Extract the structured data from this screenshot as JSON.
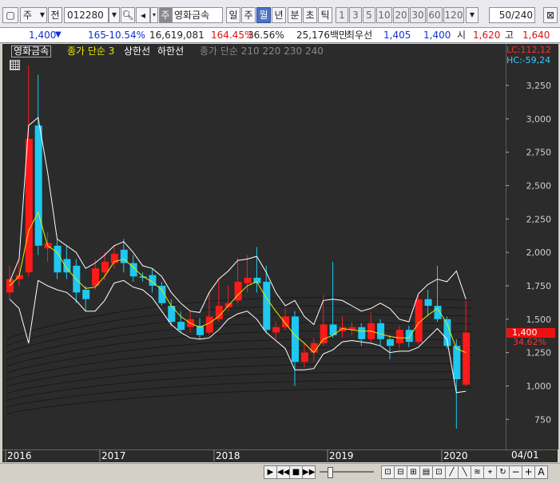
{
  "toolbar": {
    "market_type": "주",
    "prev_label": "전",
    "stock_code": "012280",
    "stock_name": "영화금속",
    "period_tabs": [
      "일",
      "주",
      "월",
      "년"
    ],
    "interval_tabs": [
      "분",
      "초",
      "틱"
    ],
    "number_tabs": [
      "1",
      "3",
      "5",
      "10",
      "20",
      "30",
      "60",
      "120"
    ],
    "count_value": "50",
    "count_total": "/240"
  },
  "info": {
    "price": "1,400",
    "change": "165",
    "change_pct": "-10.54%",
    "volume": "16,619,081",
    "vol_ratio": "164.45%",
    "turnover": "36.56%",
    "amount": "25,176백만",
    "best_ask_label": "최우선",
    "best_ask": "1,405",
    "best_bid": "1,400",
    "open_label": "시",
    "open": "1,620",
    "high_label": "고",
    "high": "1,640"
  },
  "legend": {
    "name": "영화금속",
    "close_ma": "종가 단순 3",
    "upper": "상한선",
    "lower": "하한선",
    "ribbon": "종가 단순 210 220 230 240"
  },
  "axis": {
    "lc_label": "LC:112,12",
    "hc_label": "HC:-59,24",
    "price_ticks": [
      "3,250",
      "3,000",
      "2,750",
      "2,500",
      "2,250",
      "2,000",
      "1,750",
      "1,500",
      "1,250",
      "1,000",
      "750"
    ],
    "current_price_label": "1,400",
    "current_pct_label": "34.62%",
    "year_labels": [
      "2016",
      "2017",
      "2018",
      "2019",
      "2020"
    ],
    "right_date": "04/01"
  },
  "colors": {
    "up": "#ff1a1a",
    "down": "#1ec8f0",
    "ma": "#e8e800",
    "band": "#ffffff",
    "background": "#2b2b2b"
  },
  "chart_data": {
    "type": "candlestick",
    "period": "monthly",
    "ylim": [
      650,
      3400
    ],
    "candles": [
      {
        "o": 1700,
        "c": 1800,
        "h": 1900,
        "l": 1650,
        "up": true
      },
      {
        "o": 1800,
        "c": 1830,
        "h": 1950,
        "l": 1750,
        "up": true
      },
      {
        "o": 1850,
        "c": 2850,
        "h": 3400,
        "l": 1820,
        "up": true
      },
      {
        "o": 2950,
        "c": 2050,
        "h": 3330,
        "l": 1980,
        "up": false
      },
      {
        "o": 2030,
        "c": 2070,
        "h": 2150,
        "l": 1930,
        "up": true
      },
      {
        "o": 2050,
        "c": 1850,
        "h": 2100,
        "l": 1800,
        "up": false
      },
      {
        "o": 1950,
        "c": 1850,
        "h": 2050,
        "l": 1800,
        "up": false
      },
      {
        "o": 1900,
        "c": 1700,
        "h": 1950,
        "l": 1620,
        "up": false
      },
      {
        "o": 1720,
        "c": 1650,
        "h": 1750,
        "l": 1560,
        "up": false
      },
      {
        "o": 1750,
        "c": 1880,
        "h": 1950,
        "l": 1720,
        "up": true
      },
      {
        "o": 1850,
        "c": 1930,
        "h": 2000,
        "l": 1790,
        "up": true
      },
      {
        "o": 1920,
        "c": 1990,
        "h": 2050,
        "l": 1880,
        "up": true
      },
      {
        "o": 2020,
        "c": 1920,
        "h": 2100,
        "l": 1850,
        "up": false
      },
      {
        "o": 1920,
        "c": 1820,
        "h": 1980,
        "l": 1780,
        "up": false
      },
      {
        "o": 1820,
        "c": 1810,
        "h": 1850,
        "l": 1780,
        "up": false
      },
      {
        "o": 1830,
        "c": 1750,
        "h": 1880,
        "l": 1700,
        "up": false
      },
      {
        "o": 1750,
        "c": 1620,
        "h": 1780,
        "l": 1600,
        "up": false
      },
      {
        "o": 1600,
        "c": 1480,
        "h": 1650,
        "l": 1450,
        "up": false
      },
      {
        "o": 1480,
        "c": 1420,
        "h": 1560,
        "l": 1400,
        "up": false
      },
      {
        "o": 1440,
        "c": 1500,
        "h": 1560,
        "l": 1400,
        "up": true
      },
      {
        "o": 1450,
        "c": 1380,
        "h": 1510,
        "l": 1350,
        "up": false
      },
      {
        "o": 1400,
        "c": 1520,
        "h": 1700,
        "l": 1380,
        "up": true
      },
      {
        "o": 1500,
        "c": 1600,
        "h": 1800,
        "l": 1480,
        "up": true
      },
      {
        "o": 1590,
        "c": 1620,
        "h": 1750,
        "l": 1560,
        "up": true
      },
      {
        "o": 1640,
        "c": 1780,
        "h": 1960,
        "l": 1620,
        "up": true
      },
      {
        "o": 1770,
        "c": 1810,
        "h": 1980,
        "l": 1700,
        "up": true
      },
      {
        "o": 1810,
        "c": 1770,
        "h": 2040,
        "l": 1700,
        "up": false
      },
      {
        "o": 1780,
        "c": 1420,
        "h": 1900,
        "l": 1400,
        "up": false
      },
      {
        "o": 1400,
        "c": 1440,
        "h": 1480,
        "l": 1350,
        "up": true
      },
      {
        "o": 1440,
        "c": 1520,
        "h": 1580,
        "l": 1420,
        "up": true
      },
      {
        "o": 1520,
        "c": 1180,
        "h": 1560,
        "l": 1000,
        "up": false
      },
      {
        "o": 1180,
        "c": 1250,
        "h": 1320,
        "l": 1140,
        "up": true
      },
      {
        "o": 1250,
        "c": 1320,
        "h": 1360,
        "l": 1180,
        "up": true
      },
      {
        "o": 1320,
        "c": 1460,
        "h": 1680,
        "l": 1300,
        "up": true
      },
      {
        "o": 1460,
        "c": 1380,
        "h": 1930,
        "l": 1360,
        "up": false
      },
      {
        "o": 1410,
        "c": 1440,
        "h": 1520,
        "l": 1360,
        "up": true
      },
      {
        "o": 1420,
        "c": 1440,
        "h": 1480,
        "l": 1380,
        "up": true
      },
      {
        "o": 1440,
        "c": 1350,
        "h": 1470,
        "l": 1300,
        "up": false
      },
      {
        "o": 1350,
        "c": 1470,
        "h": 1550,
        "l": 1320,
        "up": true
      },
      {
        "o": 1470,
        "c": 1350,
        "h": 1500,
        "l": 1300,
        "up": false
      },
      {
        "o": 1350,
        "c": 1300,
        "h": 1380,
        "l": 1200,
        "up": false
      },
      {
        "o": 1320,
        "c": 1420,
        "h": 1450,
        "l": 1280,
        "up": true
      },
      {
        "o": 1420,
        "c": 1330,
        "h": 1450,
        "l": 1290,
        "up": false
      },
      {
        "o": 1330,
        "c": 1650,
        "h": 1680,
        "l": 1310,
        "up": true
      },
      {
        "o": 1650,
        "c": 1600,
        "h": 1720,
        "l": 1520,
        "up": false
      },
      {
        "o": 1600,
        "c": 1500,
        "h": 1900,
        "l": 1480,
        "up": false
      },
      {
        "o": 1500,
        "c": 1300,
        "h": 1520,
        "l": 1280,
        "up": false
      },
      {
        "o": 1300,
        "c": 1050,
        "h": 1350,
        "l": 680,
        "up": false
      },
      {
        "o": 1010,
        "c": 1400,
        "h": 1640,
        "l": 1000,
        "up": true
      }
    ],
    "ma3": [
      1750,
      1820,
      2160,
      2300,
      2050,
      2000,
      1880,
      1800,
      1730,
      1740,
      1820,
      1930,
      1950,
      1890,
      1820,
      1780,
      1720,
      1600,
      1520,
      1470,
      1440,
      1470,
      1520,
      1600,
      1680,
      1750,
      1780,
      1660,
      1560,
      1470,
      1380,
      1320,
      1250,
      1350,
      1380,
      1430,
      1420,
      1410,
      1410,
      1390,
      1370,
      1360,
      1360,
      1470,
      1530,
      1580,
      1470,
      1280,
      1250
    ],
    "upper_band": [
      1780,
      1950,
      2950,
      3010,
      2600,
      2100,
      2050,
      2000,
      1880,
      1920,
      1980,
      2050,
      2080,
      2000,
      1900,
      1880,
      1820,
      1700,
      1620,
      1560,
      1550,
      1700,
      1800,
      1860,
      1940,
      1950,
      1970,
      1850,
      1700,
      1600,
      1640,
      1520,
      1460,
      1640,
      1650,
      1640,
      1600,
      1560,
      1580,
      1620,
      1580,
      1500,
      1480,
      1690,
      1760,
      1800,
      1780,
      1860,
      1650
    ],
    "lower_band": [
      1650,
      1580,
      1320,
      1790,
      1750,
      1720,
      1700,
      1640,
      1560,
      1560,
      1640,
      1770,
      1790,
      1740,
      1720,
      1660,
      1560,
      1460,
      1400,
      1360,
      1350,
      1360,
      1420,
      1500,
      1540,
      1560,
      1500,
      1400,
      1340,
      1280,
      1120,
      1120,
      1130,
      1240,
      1270,
      1330,
      1340,
      1330,
      1320,
      1300,
      1250,
      1260,
      1260,
      1290,
      1360,
      1430,
      1350,
      950,
      960
    ],
    "ribbon_lines": 12,
    "ribbon_range": [
      [
        790,
        1350
      ],
      [
        980,
        1620
      ]
    ]
  }
}
